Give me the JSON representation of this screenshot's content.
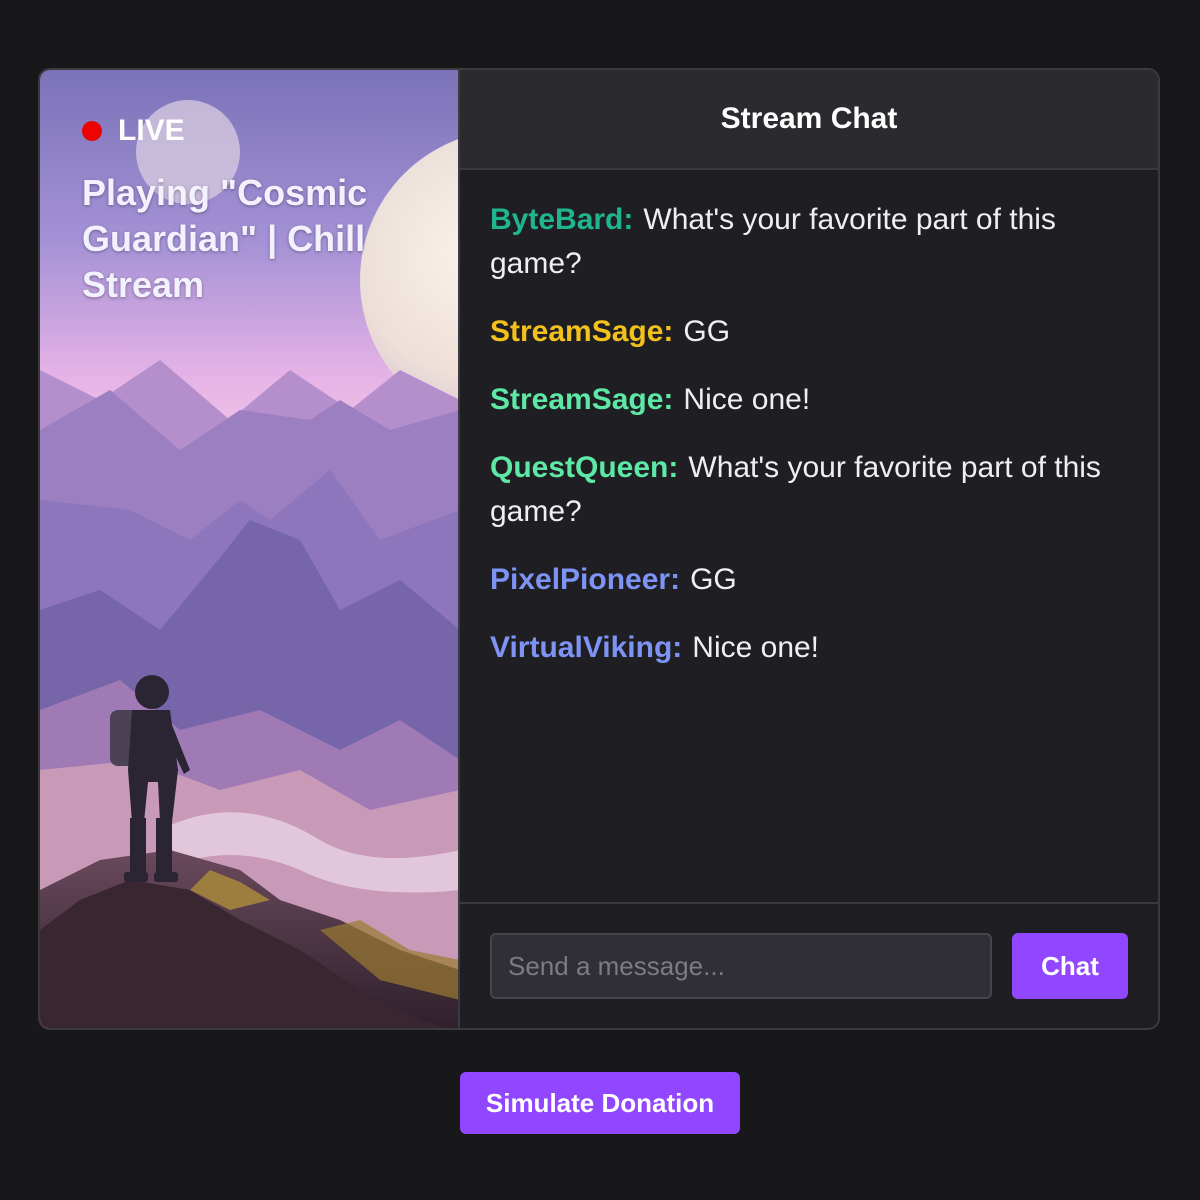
{
  "stream": {
    "live_label": "LIVE",
    "title": "Playing \"Cosmic Guardian\" | Chill Stream"
  },
  "chat": {
    "header": "Stream Chat",
    "messages": [
      {
        "user": "ByteBard:",
        "text": "What's your favorite part of this game?",
        "color": "#1fb58e"
      },
      {
        "user": "StreamSage:",
        "text": "GG",
        "color": "#f2c11b"
      },
      {
        "user": "StreamSage:",
        "text": "Nice one!",
        "color": "#5ee8a5"
      },
      {
        "user": "QuestQueen:",
        "text": "What's your favorite part of this game?",
        "color": "#5ee8a5"
      },
      {
        "user": "PixelPioneer:",
        "text": "GG",
        "color": "#7d94f5"
      },
      {
        "user": "VirtualViking:",
        "text": "Nice one!",
        "color": "#7d94f5"
      }
    ],
    "input_placeholder": "Send a message...",
    "send_label": "Chat"
  },
  "donate_label": "Simulate Donation",
  "colors": {
    "accent": "#9147ff",
    "live": "#eb0400",
    "background": "#18181b"
  }
}
